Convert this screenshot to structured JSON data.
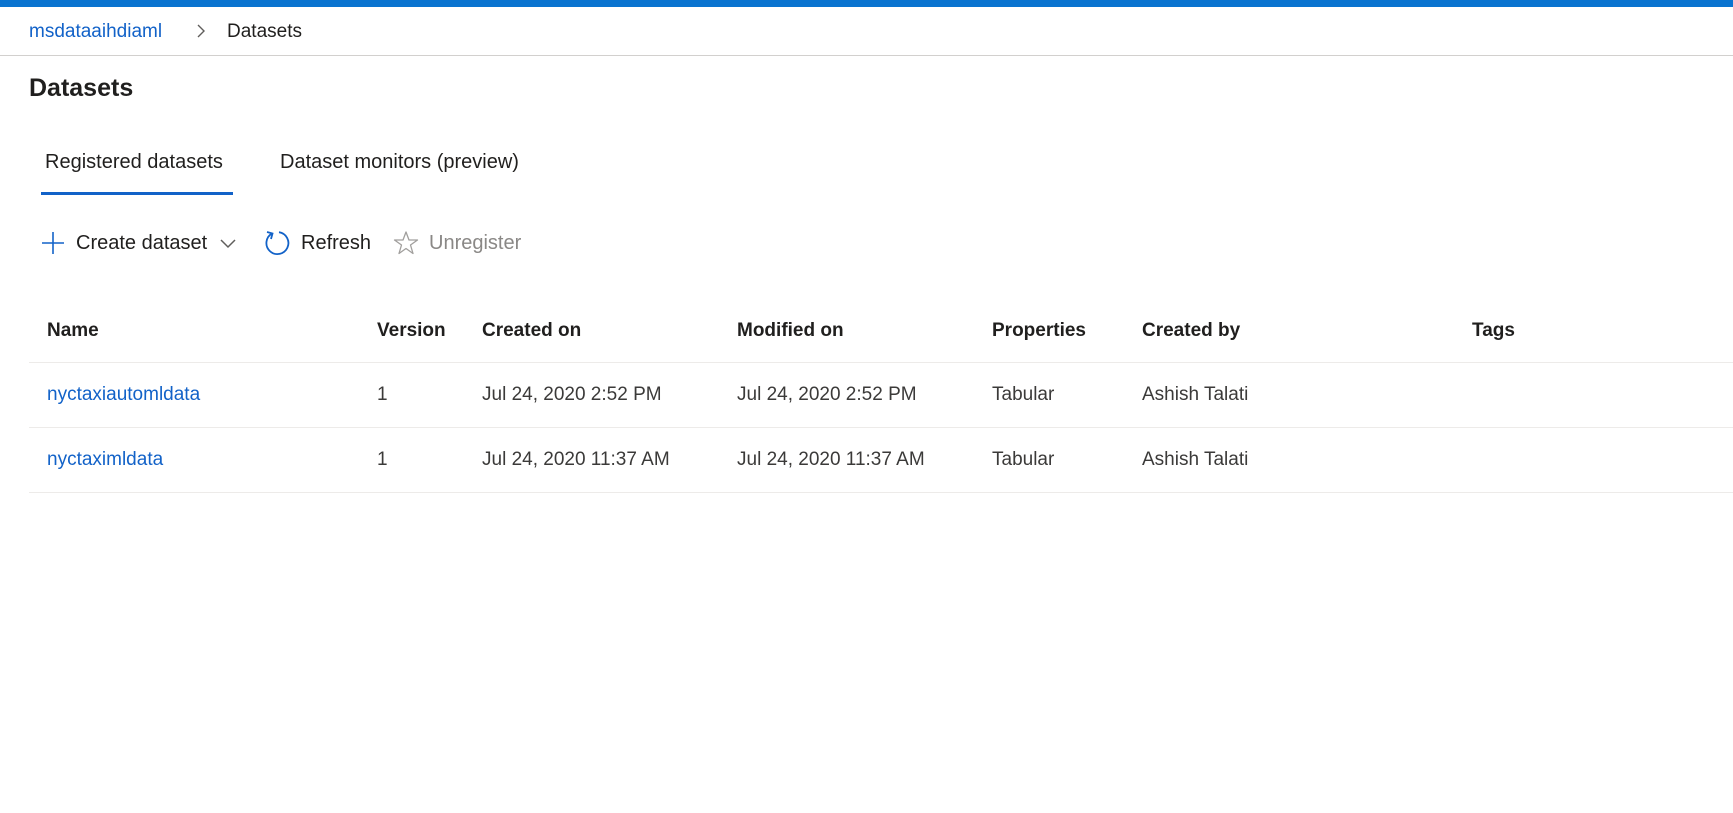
{
  "colors": {
    "accent": "#0a74d0",
    "link": "#1262c8",
    "text": "#201f1e",
    "muted": "#8a8886"
  },
  "breadcrumb": {
    "workspace": "msdataaihdiaml",
    "separator_icon": "chevron-right-icon",
    "current": "Datasets"
  },
  "page": {
    "title": "Datasets"
  },
  "tabs": [
    {
      "label": "Registered datasets",
      "selected": true
    },
    {
      "label": "Dataset monitors (preview)",
      "selected": false
    }
  ],
  "toolbar": {
    "create": {
      "label": "Create dataset",
      "icon": "plus-icon",
      "menu_icon": "chevron-down-icon"
    },
    "refresh": {
      "label": "Refresh",
      "icon": "refresh-icon"
    },
    "unregister": {
      "label": "Unregister",
      "icon": "star-icon",
      "disabled": true
    }
  },
  "table": {
    "columns": [
      "Name",
      "Version",
      "Created on",
      "Modified on",
      "Properties",
      "Created by",
      "Tags"
    ],
    "rows": [
      {
        "name": "nyctaxiautomldata",
        "version": "1",
        "created_on": "Jul 24, 2020 2:52 PM",
        "modified_on": "Jul 24, 2020 2:52 PM",
        "properties": "Tabular",
        "created_by": "Ashish Talati",
        "tags": ""
      },
      {
        "name": "nyctaximldata",
        "version": "1",
        "created_on": "Jul 24, 2020 11:37 AM",
        "modified_on": "Jul 24, 2020 11:37 AM",
        "properties": "Tabular",
        "created_by": "Ashish Talati",
        "tags": ""
      }
    ]
  }
}
